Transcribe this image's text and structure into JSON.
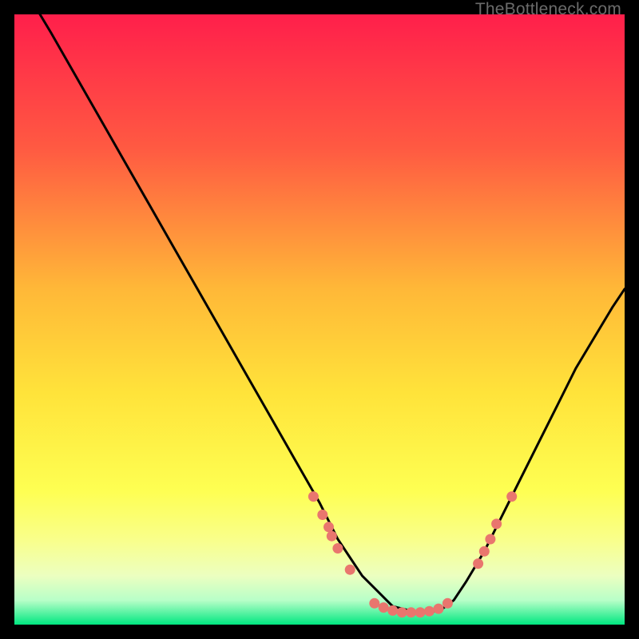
{
  "attribution": "TheBottleneck.com",
  "colors": {
    "gradient_top": "#ff1f4b",
    "gradient_mid_upper": "#ff7a3a",
    "gradient_mid": "#ffd335",
    "gradient_mid_lower": "#feff52",
    "gradient_pale": "#f6ffb4",
    "gradient_bottom": "#00e780",
    "curve": "#000000",
    "dot": "#e9766e",
    "frame": "#000000"
  },
  "chart_data": {
    "type": "line",
    "title": "",
    "xlabel": "",
    "ylabel": "",
    "xlim": [
      0,
      100
    ],
    "ylim": [
      0,
      100
    ],
    "series": [
      {
        "name": "bottleneck-curve",
        "x": [
          0,
          3,
          6,
          10,
          14,
          18,
          22,
          26,
          30,
          34,
          38,
          42,
          46,
          50,
          53,
          55,
          57,
          59,
          61,
          62,
          64,
          66,
          68,
          70,
          72,
          74,
          77,
          80,
          83,
          86,
          89,
          92,
          95,
          98,
          100
        ],
        "y": [
          108,
          102,
          97,
          90,
          83,
          76,
          69,
          62,
          55,
          48,
          41,
          34,
          27,
          20,
          14,
          11,
          8,
          6,
          4,
          3,
          2.5,
          2,
          2,
          2.5,
          4,
          7,
          12,
          18,
          24,
          30,
          36,
          42,
          47,
          52,
          55
        ]
      }
    ],
    "points": [
      {
        "x": 49,
        "y": 21
      },
      {
        "x": 50.5,
        "y": 18
      },
      {
        "x": 51.5,
        "y": 16
      },
      {
        "x": 52,
        "y": 14.5
      },
      {
        "x": 53,
        "y": 12.5
      },
      {
        "x": 55,
        "y": 9
      },
      {
        "x": 59,
        "y": 3.5
      },
      {
        "x": 60.5,
        "y": 2.8
      },
      {
        "x": 62,
        "y": 2.3
      },
      {
        "x": 63.5,
        "y": 2
      },
      {
        "x": 65,
        "y": 2
      },
      {
        "x": 66.5,
        "y": 2
      },
      {
        "x": 68,
        "y": 2.2
      },
      {
        "x": 69.5,
        "y": 2.6
      },
      {
        "x": 71,
        "y": 3.5
      },
      {
        "x": 76,
        "y": 10
      },
      {
        "x": 77,
        "y": 12
      },
      {
        "x": 78,
        "y": 14
      },
      {
        "x": 79,
        "y": 16.5
      },
      {
        "x": 81.5,
        "y": 21
      }
    ]
  }
}
